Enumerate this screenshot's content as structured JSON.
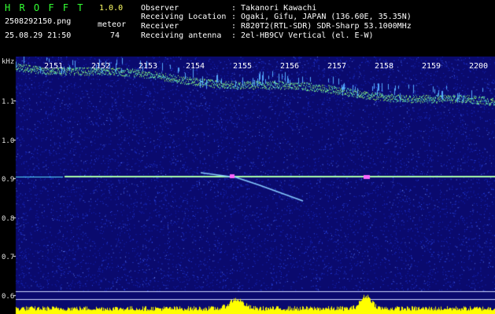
{
  "header": {
    "app_title": "H R O F F T",
    "version": "1.0.0",
    "filename": "2508292150.png",
    "timestamp": "25.08.29 21:50",
    "meteor_label": "meteor",
    "meteor_count": "74",
    "info": [
      {
        "label": "Observer",
        "sep": ":",
        "value": "Takanori Kawachi"
      },
      {
        "label": "Receiving Location",
        "sep": ":",
        "value": "Ogaki, Gifu, JAPAN (136.60E, 35.35N)"
      },
      {
        "label": "Receiver",
        "sep": ":",
        "value": "R820T2(RTL-SDR) SDR-Sharp 53.1000MHz"
      },
      {
        "label": "Receiving antenna",
        "sep": ":",
        "value": "2el-HB9CV Vertical (el. E-W)"
      }
    ]
  },
  "spectrogram": {
    "y_unit": "kHz",
    "y_ticks": [
      "1.1",
      "1.0",
      "0.9",
      "0.8",
      "0.7",
      "0.6"
    ],
    "x_ticks": [
      "2151",
      "2152",
      "2153",
      "2154",
      "2155",
      "2156",
      "2157",
      "2158",
      "2159",
      "2200"
    ],
    "colors": {
      "background": "#0a0a6e",
      "noise": "#3355ff",
      "carrier": "#aaffaa",
      "echo": "#ff66ff",
      "level_bar": "#ffff00",
      "header_text": "#ffffff",
      "accent_text": "#33ff33"
    }
  }
}
